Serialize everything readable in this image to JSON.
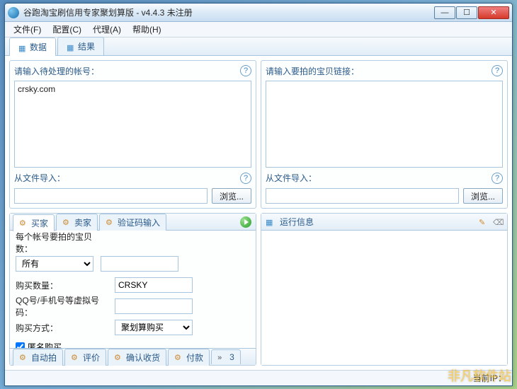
{
  "window": {
    "title": "谷跑淘宝刷信用专家聚划算版 - v4.4.3 未注册"
  },
  "menu": {
    "file": "文件(F)",
    "config": "配置(C)",
    "proxy": "代理(A)",
    "help": "帮助(H)"
  },
  "main_tabs": {
    "data": "数据",
    "result": "结果"
  },
  "left_panel": {
    "label": "请输入待处理的帐号：",
    "text": "crsky.com",
    "import_label": "从文件导入：",
    "import_value": "",
    "browse": "浏览..."
  },
  "right_panel": {
    "label": "请输入要拍的宝贝链接：",
    "text": "",
    "import_label": "从文件导入：",
    "import_value": "",
    "browse": "浏览..."
  },
  "buyer_tabs": {
    "buyer": "买家",
    "seller": "卖家",
    "captcha": "验证码输入"
  },
  "buyer_form": {
    "items_label": "每个帐号要拍的宝贝数：",
    "items_select": "所有",
    "items_extra": "",
    "qty_label": "购买数量：",
    "qty_value": "CRSKY",
    "qq_label": "QQ号/手机号等虚拟号码：",
    "qq_value": "",
    "method_label": "购买方式：",
    "method_value": "聚划算购买",
    "anon_label": "匿名购买",
    "anon_checked": true
  },
  "bottom_tabs": {
    "autobid": "自动拍",
    "review": "评价",
    "confirm": "确认收货",
    "pay": "付款",
    "more": "3"
  },
  "run_panel": {
    "title": "运行信息",
    "log": ""
  },
  "status": {
    "ip_label": "当前IP：",
    "ip_value": ""
  },
  "watermark": "非凡软件站"
}
